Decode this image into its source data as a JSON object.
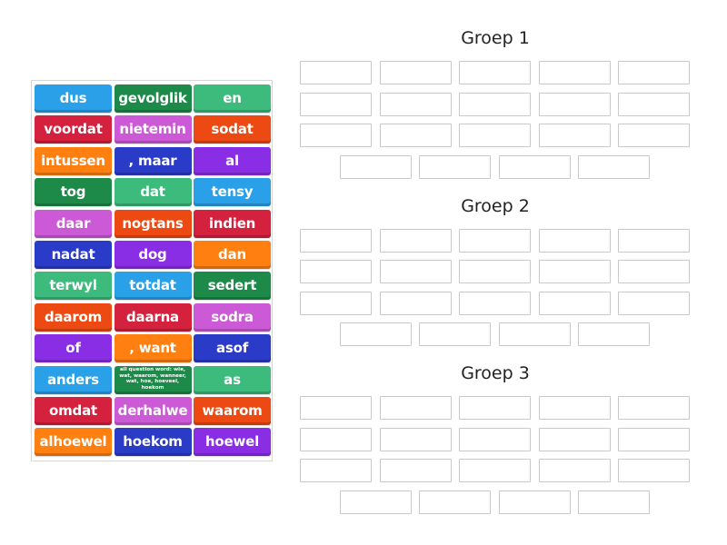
{
  "activity": {
    "type": "group sort",
    "tile_bank": {
      "columns": 3,
      "tiles": [
        {
          "label": "dus",
          "color": "#2aa0e8"
        },
        {
          "label": "gevolglik",
          "color": "#1e8a4a"
        },
        {
          "label": "en",
          "color": "#3dbb7d"
        },
        {
          "label": "voordat",
          "color": "#d4213d"
        },
        {
          "label": "nietemin",
          "color": "#cc5ad6"
        },
        {
          "label": "sodat",
          "color": "#ec4a12"
        },
        {
          "label": "intussen",
          "color": "#ff7f10"
        },
        {
          "label": ", maar",
          "color": "#2a3bc8"
        },
        {
          "label": "al",
          "color": "#8a2ee6"
        },
        {
          "label": "tog",
          "color": "#1e8a4a"
        },
        {
          "label": "dat",
          "color": "#3dbb7d"
        },
        {
          "label": "tensy",
          "color": "#2aa0e8"
        },
        {
          "label": "daar",
          "color": "#cc5ad6"
        },
        {
          "label": "nogtans",
          "color": "#ec4a12"
        },
        {
          "label": "indien",
          "color": "#d4213d"
        },
        {
          "label": "nadat",
          "color": "#2a3bc8"
        },
        {
          "label": "dog",
          "color": "#8a2ee6"
        },
        {
          "label": "dan",
          "color": "#ff7f10"
        },
        {
          "label": "terwyl",
          "color": "#3dbb7d"
        },
        {
          "label": "totdat",
          "color": "#2aa0e8"
        },
        {
          "label": "sedert",
          "color": "#1e8a4a"
        },
        {
          "label": "daarom",
          "color": "#ec4a12"
        },
        {
          "label": "daarna",
          "color": "#d4213d"
        },
        {
          "label": "sodra",
          "color": "#cc5ad6"
        },
        {
          "label": "of",
          "color": "#8a2ee6"
        },
        {
          "label": ", want",
          "color": "#ff7f10"
        },
        {
          "label": "asof",
          "color": "#2a3bc8"
        },
        {
          "label": "anders",
          "color": "#2aa0e8"
        },
        {
          "label": "all question word: wie, wat, waarom, wanneer, wat, hoe, hoeveel, hoekom",
          "color": "#1e8a4a",
          "small": true
        },
        {
          "label": "as",
          "color": "#3dbb7d"
        },
        {
          "label": "omdat",
          "color": "#d4213d"
        },
        {
          "label": "derhalwe",
          "color": "#cc5ad6"
        },
        {
          "label": "waarom",
          "color": "#ec4a12"
        },
        {
          "label": "alhoewel",
          "color": "#ff7f10"
        },
        {
          "label": "hoekom",
          "color": "#2a3bc8"
        },
        {
          "label": "hoewel",
          "color": "#8a2ee6"
        }
      ]
    },
    "groups": [
      {
        "title": "Groep 1",
        "slot_rows": [
          5,
          5,
          5,
          4
        ]
      },
      {
        "title": "Groep 2",
        "slot_rows": [
          5,
          5,
          5,
          4
        ]
      },
      {
        "title": "Groep 3",
        "slot_rows": [
          5,
          5,
          5,
          4
        ]
      }
    ]
  }
}
